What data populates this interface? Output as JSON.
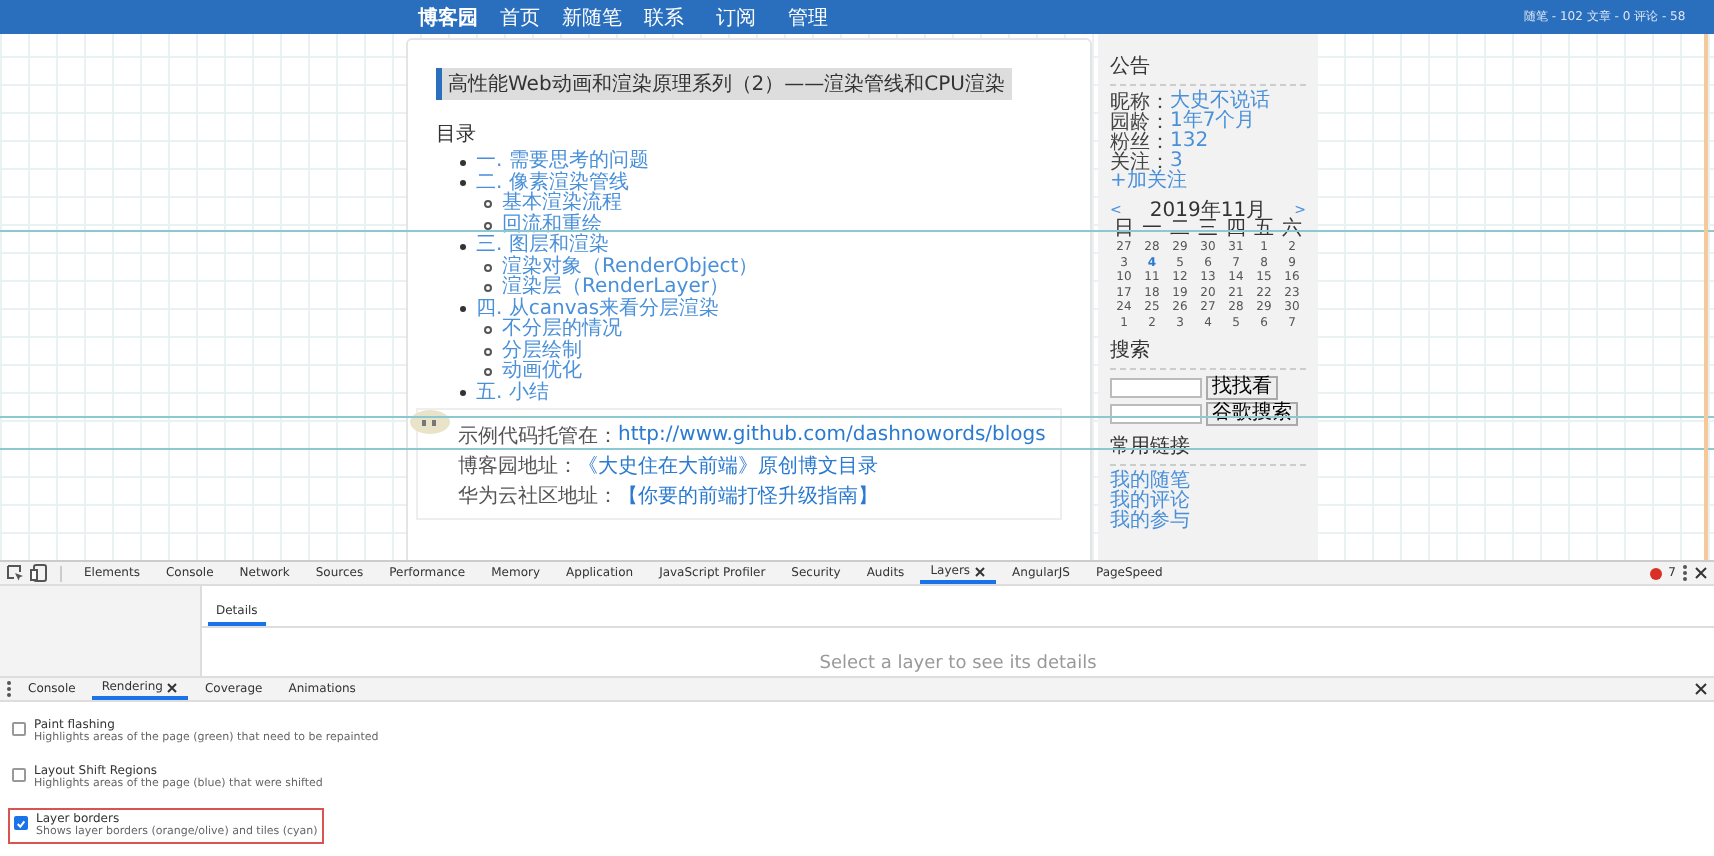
{
  "nav": {
    "items": [
      "博客园",
      "首页",
      "新随笔",
      "联系",
      "订阅",
      "管理"
    ],
    "stats": "随笔 - 102  文章 - 0  评论 - 58"
  },
  "article": {
    "title": "高性能Web动画和渲染原理系列（2）——渲染管线和CPU渲染",
    "toc_heading": "目录",
    "toc": [
      {
        "label": "一. 需要思考的问题"
      },
      {
        "label": "二. 像素渲染管线",
        "children": [
          {
            "label": "基本渲染流程"
          },
          {
            "label": "回流和重绘"
          }
        ]
      },
      {
        "label": "三. 图层和渲染",
        "children": [
          {
            "label": "渲染对象（RenderObject）"
          },
          {
            "label": "渲染层（RenderLayer）"
          }
        ]
      },
      {
        "label": "四. 从canvas来看分层渲染",
        "children": [
          {
            "label": "不分层的情况"
          },
          {
            "label": "分层绘制"
          },
          {
            "label": "动画优化"
          }
        ]
      },
      {
        "label": "五. 小结"
      }
    ],
    "notes": [
      {
        "label": "示例代码托管在：",
        "link": "http://www.github.com/dashnowords/blogs"
      },
      {
        "label": "博客园地址：",
        "link": "《大史住在大前端》原创博文目录"
      },
      {
        "label": "华为云社区地址：",
        "link": "【你要的前端打怪升级指南】"
      }
    ]
  },
  "sidebar": {
    "notice": {
      "heading": "公告",
      "rows": [
        {
          "label": "昵称：",
          "value": "大史不说话"
        },
        {
          "label": "园龄：",
          "value": "1年7个月"
        },
        {
          "label": "粉丝：",
          "value": "132"
        },
        {
          "label": "关注：",
          "value": "3"
        }
      ],
      "follow": "+加关注"
    },
    "calendar": {
      "prev": "<",
      "title": "2019年11月",
      "next": ">",
      "weekdays": [
        "日",
        "一",
        "二",
        "三",
        "四",
        "五",
        "六"
      ],
      "weeks": [
        [
          {
            "day": "27",
            "has_post": false
          },
          {
            "day": "28",
            "has_post": false
          },
          {
            "day": "29",
            "has_post": false
          },
          {
            "day": "30",
            "has_post": false
          },
          {
            "day": "31",
            "has_post": false
          },
          {
            "day": "1",
            "has_post": false
          },
          {
            "day": "2",
            "has_post": false
          }
        ],
        [
          {
            "day": "3",
            "has_post": false
          },
          {
            "day": "4",
            "has_post": true
          },
          {
            "day": "5",
            "has_post": false
          },
          {
            "day": "6",
            "has_post": false
          },
          {
            "day": "7",
            "has_post": false
          },
          {
            "day": "8",
            "has_post": false
          },
          {
            "day": "9",
            "has_post": false
          }
        ],
        [
          {
            "day": "10",
            "has_post": false
          },
          {
            "day": "11",
            "has_post": false
          },
          {
            "day": "12",
            "has_post": false
          },
          {
            "day": "13",
            "has_post": false
          },
          {
            "day": "14",
            "has_post": false
          },
          {
            "day": "15",
            "has_post": false
          },
          {
            "day": "16",
            "has_post": false
          }
        ],
        [
          {
            "day": "17",
            "has_post": false
          },
          {
            "day": "18",
            "has_post": false
          },
          {
            "day": "19",
            "has_post": false
          },
          {
            "day": "20",
            "has_post": false
          },
          {
            "day": "21",
            "has_post": false
          },
          {
            "day": "22",
            "has_post": false
          },
          {
            "day": "23",
            "has_post": false
          }
        ],
        [
          {
            "day": "24",
            "has_post": false
          },
          {
            "day": "25",
            "has_post": false
          },
          {
            "day": "26",
            "has_post": false
          },
          {
            "day": "27",
            "has_post": false
          },
          {
            "day": "28",
            "has_post": false
          },
          {
            "day": "29",
            "has_post": false
          },
          {
            "day": "30",
            "has_post": false
          }
        ],
        [
          {
            "day": "1",
            "has_post": false
          },
          {
            "day": "2",
            "has_post": false
          },
          {
            "day": "3",
            "has_post": false
          },
          {
            "day": "4",
            "has_post": false
          },
          {
            "day": "5",
            "has_post": false
          },
          {
            "day": "6",
            "has_post": false
          },
          {
            "day": "7",
            "has_post": false
          }
        ]
      ]
    },
    "search": {
      "heading": "搜索",
      "buttons": [
        "找找看",
        "谷歌搜索"
      ]
    },
    "links": {
      "heading": "常用链接",
      "items": [
        "我的随笔",
        "我的评论",
        "我的参与"
      ]
    }
  },
  "devtools": {
    "tabs": [
      {
        "label": "Elements",
        "selected": false,
        "closable": false
      },
      {
        "label": "Console",
        "selected": false,
        "closable": false
      },
      {
        "label": "Network",
        "selected": false,
        "closable": false
      },
      {
        "label": "Sources",
        "selected": false,
        "closable": false
      },
      {
        "label": "Performance",
        "selected": false,
        "closable": false
      },
      {
        "label": "Memory",
        "selected": false,
        "closable": false
      },
      {
        "label": "Application",
        "selected": false,
        "closable": false
      },
      {
        "label": "JavaScript Profiler",
        "selected": false,
        "closable": false
      },
      {
        "label": "Security",
        "selected": false,
        "closable": false
      },
      {
        "label": "Audits",
        "selected": false,
        "closable": false
      },
      {
        "label": "Layers",
        "selected": true,
        "closable": true
      },
      {
        "label": "AngularJS",
        "selected": false,
        "closable": false
      },
      {
        "label": "PageSpeed",
        "selected": false,
        "closable": false
      }
    ],
    "error_count": "7",
    "layers": {
      "tabs": [
        {
          "label": "Details",
          "selected": true
        }
      ],
      "message": "Select a layer to see its details"
    },
    "drawer": {
      "tabs": [
        {
          "label": "Console",
          "selected": false,
          "closable": false
        },
        {
          "label": "Rendering",
          "selected": true,
          "closable": true
        },
        {
          "label": "Coverage",
          "selected": false,
          "closable": false
        },
        {
          "label": "Animations",
          "selected": false,
          "closable": false
        }
      ]
    },
    "options": [
      {
        "title": "Paint flashing",
        "description": "Highlights areas of the page (green) that need to be repainted",
        "checked": false,
        "highlighted": false
      },
      {
        "title": "Layout Shift Regions",
        "description": "Highlights areas of the page (blue) that were shifted",
        "checked": false,
        "highlighted": false
      },
      {
        "title": "Layer borders",
        "description": "Shows layer borders (orange/olive) and tiles (cyan)",
        "checked": true,
        "highlighted": true
      }
    ]
  }
}
